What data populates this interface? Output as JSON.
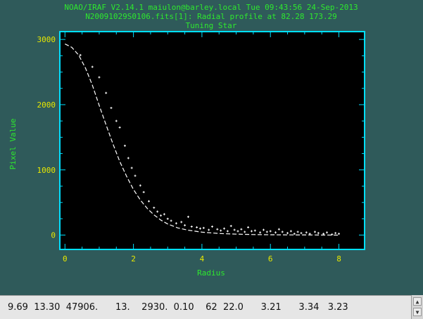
{
  "header": {
    "line1": "NOAO/IRAF V2.14.1 maiulon@barley.local Tue 09:43:56 24-Sep-2013",
    "line2": "N20091029S0106.fits[1]: Radial profile at 82.28 173.29",
    "line3": "Tuning Star"
  },
  "status": {
    "text": "9.69  13.30  47906.      13.    2930.  0.10    62  22.0      3.21      3.34   3.23"
  },
  "icons": {
    "scroll_up": "triangle-up-icon",
    "scroll_down": "triangle-down-icon"
  },
  "colors": {
    "background": "#2f5a5a",
    "frame": "#00e0ff",
    "plot_bg": "#000000",
    "data": "#ffffff",
    "ticks": "#e8e800",
    "labels": "#2ee82e"
  },
  "chart_data": {
    "type": "scatter",
    "title": "Tuning Star",
    "xlabel": "Radius",
    "ylabel": "Pixel Value",
    "xlim": [
      -0.15,
      8.75
    ],
    "ylim": [
      -220,
      3120
    ],
    "x_ticks": [
      0,
      2,
      4,
      6,
      8
    ],
    "y_ticks": [
      0,
      1000,
      2000,
      3000
    ],
    "series": [
      {
        "type": "scatter",
        "points": [
          [
            0.45,
            2760
          ],
          [
            0.8,
            2580
          ],
          [
            1.0,
            2420
          ],
          [
            1.2,
            2180
          ],
          [
            1.35,
            1950
          ],
          [
            1.5,
            1750
          ],
          [
            1.6,
            1650
          ],
          [
            1.75,
            1370
          ],
          [
            1.85,
            1180
          ],
          [
            1.95,
            1030
          ],
          [
            2.05,
            910
          ],
          [
            2.2,
            760
          ],
          [
            2.3,
            660
          ],
          [
            2.45,
            520
          ],
          [
            2.6,
            420
          ],
          [
            2.7,
            360
          ],
          [
            2.8,
            300
          ],
          [
            2.9,
            320
          ],
          [
            3.0,
            250
          ],
          [
            3.1,
            220
          ],
          [
            3.25,
            180
          ],
          [
            3.4,
            200
          ],
          [
            3.5,
            150
          ],
          [
            3.6,
            280
          ],
          [
            3.7,
            130
          ],
          [
            3.85,
            120
          ],
          [
            3.95,
            100
          ],
          [
            4.05,
            110
          ],
          [
            4.2,
            80
          ],
          [
            4.3,
            130
          ],
          [
            4.45,
            90
          ],
          [
            4.55,
            70
          ],
          [
            4.65,
            100
          ],
          [
            4.75,
            60
          ],
          [
            4.85,
            140
          ],
          [
            4.95,
            80
          ],
          [
            5.05,
            60
          ],
          [
            5.15,
            90
          ],
          [
            5.25,
            50
          ],
          [
            5.35,
            120
          ],
          [
            5.45,
            60
          ],
          [
            5.55,
            70
          ],
          [
            5.7,
            40
          ],
          [
            5.8,
            80
          ],
          [
            5.9,
            50
          ],
          [
            6.0,
            60
          ],
          [
            6.15,
            40
          ],
          [
            6.25,
            90
          ],
          [
            6.35,
            50
          ],
          [
            6.5,
            30
          ],
          [
            6.6,
            60
          ],
          [
            6.7,
            20
          ],
          [
            6.8,
            50
          ],
          [
            6.9,
            30
          ],
          [
            7.05,
            40
          ],
          [
            7.15,
            20
          ],
          [
            7.3,
            50
          ],
          [
            7.4,
            30
          ],
          [
            7.55,
            20
          ],
          [
            7.65,
            40
          ],
          [
            7.8,
            10
          ],
          [
            7.9,
            30
          ],
          [
            8.0,
            20
          ]
        ]
      },
      {
        "type": "line",
        "dashed": true,
        "x": [
          0,
          0.2,
          0.4,
          0.6,
          0.8,
          1.0,
          1.2,
          1.4,
          1.6,
          1.8,
          2.0,
          2.2,
          2.4,
          2.6,
          2.8,
          3.0,
          3.3,
          3.6,
          4.0,
          4.5,
          5.0,
          5.5,
          6.0,
          6.5,
          7.0,
          7.5,
          8.0
        ],
        "y": [
          2930,
          2880,
          2760,
          2560,
          2300,
          1990,
          1690,
          1400,
          1130,
          900,
          700,
          540,
          410,
          310,
          230,
          170,
          110,
          75,
          45,
          25,
          15,
          8,
          5,
          3,
          2,
          1,
          0
        ]
      }
    ]
  }
}
